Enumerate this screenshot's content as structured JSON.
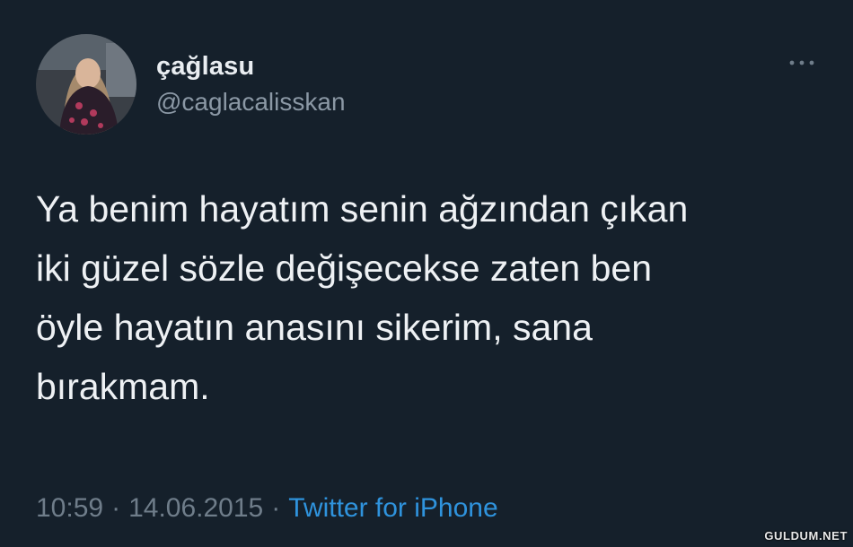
{
  "user": {
    "display_name": "çağlasu",
    "handle": "@caglacalisskan",
    "avatar_icon": "profile-photo"
  },
  "menu": {
    "icon": "more-horizontal-icon"
  },
  "tweet": {
    "lines": [
      "Ya benim hayatım senin ağzından çıkan",
      "iki güzel sözle değişecekse zaten ben",
      "öyle hayatın anasını sikerim, sana",
      "bırakmam."
    ]
  },
  "meta": {
    "time": "10:59",
    "separator": "·",
    "date": "14.06.2015",
    "source": "Twitter for iPhone"
  },
  "watermark": "GULDUM.NET",
  "colors": {
    "background": "#15202b",
    "text": "#eef1f4",
    "muted": "#6f7d8a",
    "link": "#2f93dd"
  }
}
